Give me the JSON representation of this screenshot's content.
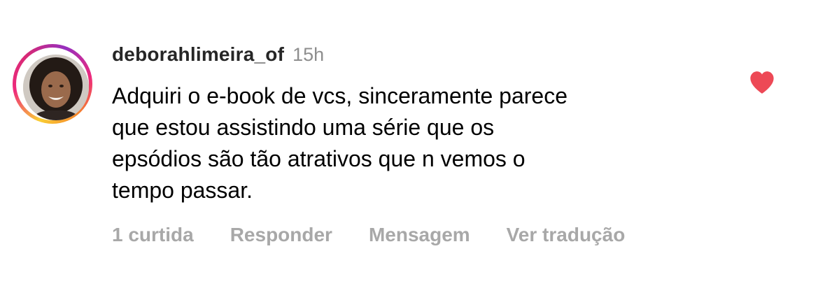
{
  "comment": {
    "username": "deborahlimeira_of",
    "time": "15h",
    "lines": [
      "Adquiri o e-book de vcs, sinceramente parece",
      "que estou assistindo uma série que os",
      "epsódios são tão atrativos que n vemos o",
      "tempo passar."
    ],
    "liked": true,
    "like_color": "#ed4956"
  },
  "actions": {
    "likes_label": "1 curtida",
    "reply_label": "Responder",
    "message_label": "Mensagem",
    "translate_label": "Ver tradução"
  },
  "icons": {
    "like": "heart-icon",
    "avatar": "profile-photo"
  }
}
